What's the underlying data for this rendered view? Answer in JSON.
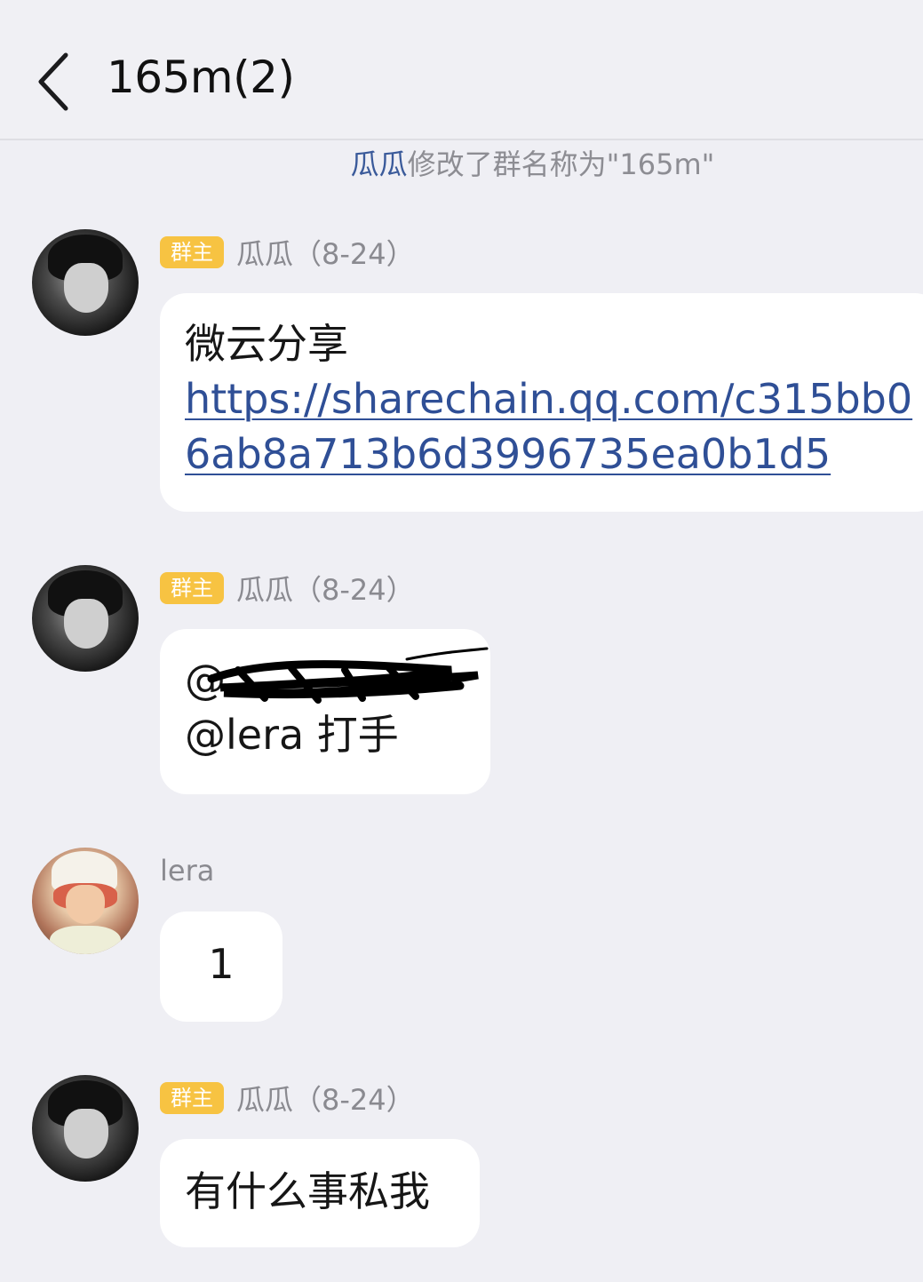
{
  "header": {
    "title": "165m(2)"
  },
  "system_message": {
    "actor": "瓜瓜",
    "text": "修改了群名称为\"165m\""
  },
  "messages": [
    {
      "badge": "群主",
      "sender": "瓜瓜（8-24）",
      "line1": "微云分享",
      "link": "https://sharechain.qq.com/c315bb06ab8a713b6d3996735ea0b1d5"
    },
    {
      "badge": "群主",
      "sender": "瓜瓜（8-24）",
      "line1": "@",
      "line2": "@lera 打手"
    },
    {
      "sender": "lera",
      "line1": "1"
    },
    {
      "badge": "群主",
      "sender": "瓜瓜（8-24）",
      "line1": "有什么事私我"
    }
  ],
  "colors": {
    "background": "#efeff4",
    "bubble": "#ffffff",
    "badge": "#f7c342",
    "link": "#2f4f96",
    "actor": "#3a5a9a"
  },
  "icons": {
    "back": "chevron-left-icon"
  }
}
